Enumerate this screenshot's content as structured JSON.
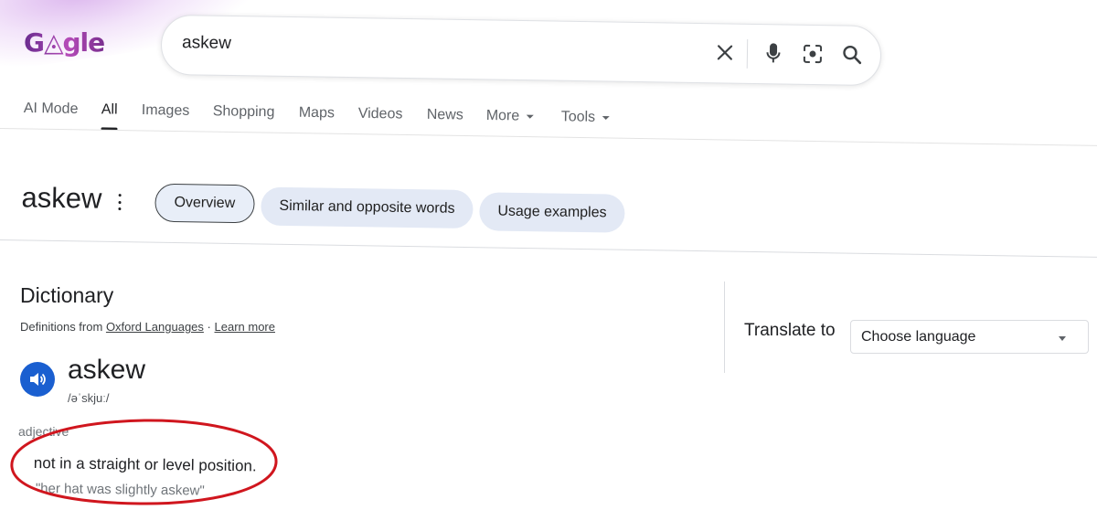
{
  "logo": {
    "text": "G◬gle"
  },
  "search": {
    "query": "askew"
  },
  "nav": {
    "tabs": [
      "AI Mode",
      "All",
      "Images",
      "Shopping",
      "Maps",
      "Videos",
      "News",
      "More",
      "Tools"
    ],
    "active": "All"
  },
  "word_header": {
    "word": "askew",
    "chips": [
      "Overview",
      "Similar and opposite words",
      "Usage examples"
    ],
    "selected_chip": "Overview"
  },
  "dictionary": {
    "title": "Dictionary",
    "source_prefix": "Definitions from",
    "source_link": "Oxford Languages",
    "separator": "·",
    "learn_more": "Learn more",
    "headword": "askew",
    "phonetic": "/əˈskjuː/",
    "part_of_speech": "adjective",
    "definition": "not in a straight or level position.",
    "example": "\"her hat was slightly askew\""
  },
  "translate": {
    "label": "Translate to",
    "placeholder": "Choose language"
  },
  "colors": {
    "annotation_circle": "#d0161e",
    "speaker_button": "#1a5fd0",
    "chip_background": "#e3e9f5"
  },
  "icons": [
    "clear-icon",
    "microphone-icon",
    "lens-camera-icon",
    "search-icon",
    "more-vert-icon",
    "speaker-icon",
    "dropdown-caret-icon"
  ]
}
